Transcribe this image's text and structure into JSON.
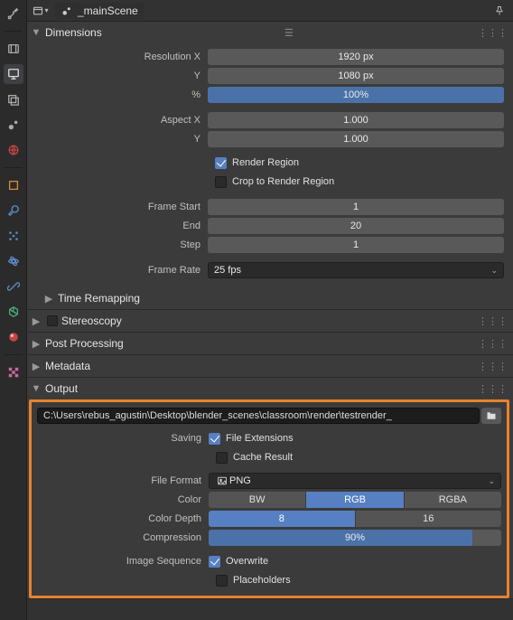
{
  "header": {
    "scene_name": "_mainScene"
  },
  "panels": {
    "dimensions": {
      "title": "Dimensions"
    },
    "time_remapping": {
      "title": "Time Remapping"
    },
    "stereoscopy": {
      "title": "Stereoscopy"
    },
    "post_processing": {
      "title": "Post Processing"
    },
    "metadata": {
      "title": "Metadata"
    },
    "output": {
      "title": "Output"
    }
  },
  "dimensions": {
    "resolution_x_label": "Resolution X",
    "resolution_x": "1920 px",
    "resolution_y_label": "Y",
    "resolution_y": "1080 px",
    "percent_label": "%",
    "percent": "100%",
    "aspect_x_label": "Aspect X",
    "aspect_x": "1.000",
    "aspect_y_label": "Y",
    "aspect_y": "1.000",
    "render_region_label": "Render Region",
    "crop_to_render_region_label": "Crop to Render Region",
    "frame_start_label": "Frame Start",
    "frame_start": "1",
    "frame_end_label": "End",
    "frame_end": "20",
    "frame_step_label": "Step",
    "frame_step": "1",
    "frame_rate_label": "Frame Rate",
    "frame_rate": "25 fps"
  },
  "output": {
    "path": "C:\\Users\\rebus_agustin\\Desktop\\blender_scenes\\classroom\\render\\testrender_",
    "saving_label": "Saving",
    "file_extensions_label": "File Extensions",
    "cache_result_label": "Cache Result",
    "file_format_label": "File Format",
    "file_format": "PNG",
    "color_label": "Color",
    "color_options": {
      "bw": "BW",
      "rgb": "RGB",
      "rgba": "RGBA"
    },
    "color_depth_label": "Color Depth",
    "color_depth_options": {
      "d8": "8",
      "d16": "16"
    },
    "compression_label": "Compression",
    "compression": "90%",
    "image_sequence_label": "Image Sequence",
    "overwrite_label": "Overwrite",
    "placeholders_label": "Placeholders"
  }
}
